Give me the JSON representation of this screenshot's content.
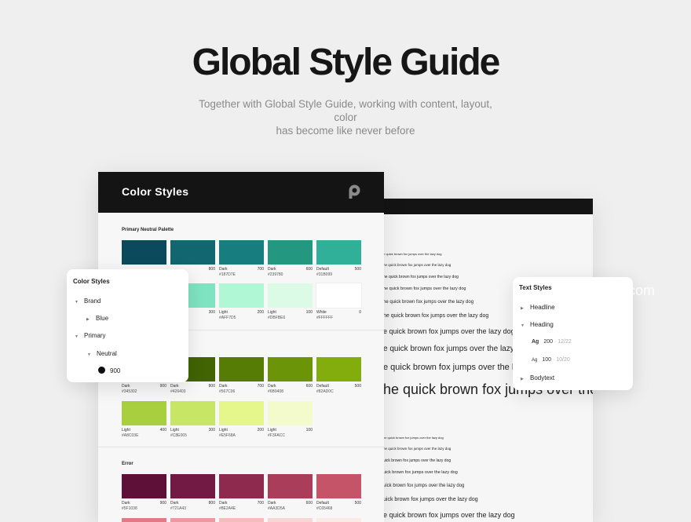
{
  "hero": {
    "title": "Global Style Guide",
    "subtitle_line1": "Together with Global Style Guide, working with content, layout, color",
    "subtitle_line2": "has become like never before"
  },
  "front_page": {
    "header_title": "Color Styles",
    "logo_icon": "p-logo-icon",
    "section_primary_neutral": "Primary Neutral Palette",
    "section_error": "Error",
    "neutral_row1": [
      {
        "name": "",
        "value": "",
        "hex": "",
        "color": "#0a4a5c"
      },
      {
        "name": "",
        "value": "800",
        "hex": "",
        "color": "#126670"
      },
      {
        "name": "Dark",
        "value": "700",
        "hex": "#187D7E",
        "color": "#187d7e"
      },
      {
        "name": "Dark",
        "value": "600",
        "hex": "#239780",
        "color": "#239780"
      },
      {
        "name": "Default",
        "value": "500",
        "hex": "#31B099",
        "color": "#31b099"
      }
    ],
    "neutral_row2": [
      {
        "name": "",
        "value": "",
        "hex": "",
        "color": "#5fd3b5"
      },
      {
        "name": "",
        "value": "300",
        "hex": "",
        "color": "#7fe3c2"
      },
      {
        "name": "Light",
        "value": "200",
        "hex": "#AFF7D5",
        "color": "#aff7d5"
      },
      {
        "name": "Light",
        "value": "100",
        "hex": "#DBFBE6",
        "color": "#dbfbe6"
      },
      {
        "name": "White",
        "value": "0",
        "hex": "#FFFFFF",
        "color": "#ffffff"
      }
    ],
    "green_row1": [
      {
        "name": "Dark",
        "value": "900",
        "hex": "#345302",
        "color": "#345302"
      },
      {
        "name": "Dark",
        "value": "800",
        "hex": "#426403",
        "color": "#426403"
      },
      {
        "name": "Dark",
        "value": "700",
        "hex": "#567C06",
        "color": "#567c06"
      },
      {
        "name": "Dark",
        "value": "600",
        "hex": "#6B9408",
        "color": "#6b9408"
      },
      {
        "name": "Default",
        "value": "500",
        "hex": "#82AD0C",
        "color": "#82ad0c"
      }
    ],
    "green_row2": [
      {
        "name": "Light",
        "value": "400",
        "hex": "#A8C03E",
        "color": "#a8cf3e"
      },
      {
        "name": "Light",
        "value": "300",
        "hex": "#C8E065",
        "color": "#c8e665"
      },
      {
        "name": "Light",
        "value": "200",
        "hex": "#E5F68A",
        "color": "#e5f68a"
      },
      {
        "name": "Light",
        "value": "100",
        "hex": "#F3FACC",
        "color": "#f3facc"
      }
    ],
    "error_row1": [
      {
        "name": "Dark",
        "value": "900",
        "hex": "#5F1038",
        "color": "#5f1038"
      },
      {
        "name": "Dark",
        "value": "800",
        "hex": "#721A43",
        "color": "#721a43"
      },
      {
        "name": "Dark",
        "value": "700",
        "hex": "#8E2A4E",
        "color": "#8e2a4e"
      },
      {
        "name": "Dark",
        "value": "600",
        "hex": "#AA3D5A",
        "color": "#aa3d5a"
      },
      {
        "name": "Default",
        "value": "500",
        "hex": "#C65468",
        "color": "#c65468"
      }
    ],
    "error_row2_colors": [
      "#e27a86",
      "#ec9a9f",
      "#f4bcbb",
      "#f8d6d3",
      "#fbe9e6"
    ]
  },
  "back_page": {
    "specimen_text": "The quick brown fox jumps over the lazy dog",
    "specimens_top": [
      {
        "text": "e quick brown fox jumps over the lazy dog",
        "size": 4
      },
      {
        "text": "he quick brown fox jumps over the lazy dog",
        "size": 4.5
      },
      {
        "text": "he quick brown fox jumps over the lazy dog",
        "size": 5
      },
      {
        "text": "he quick brown fox jumps over the lazy dog",
        "size": 5.5
      },
      {
        "text": "he quick brown fox jumps over the lazy dog",
        "size": 6
      },
      {
        "text": "he quick brown fox jumps over the lazy dog",
        "size": 7
      },
      {
        "text": "e quick brown fox jumps over the lazy dog",
        "size": 9
      },
      {
        "text": "e quick brown fox jumps over the lazy dog",
        "size": 10
      },
      {
        "text": "e quick brown fox jumps over the lazy dog",
        "size": 11
      },
      {
        "text": "he quick brown fox jumps over the lazy dog",
        "size": 18
      }
    ],
    "specimens_bottom": [
      {
        "text": "he quick brown fox jumps over the lazy dog",
        "size": 4
      },
      {
        "text": "he quick brown fox jumps over the lazy dog",
        "size": 4.5
      },
      {
        "text": "uick brown fox jumps over the lazy dog",
        "size": 5
      },
      {
        "text": "uick brown fox jumps over the lazy dog",
        "size": 5.5
      },
      {
        "text": "uick brown fox jumps over the lazy dog",
        "size": 6
      },
      {
        "text": "uick brown fox jumps over the lazy dog",
        "size": 7
      },
      {
        "text": "e quick brown fox jumps over the lazy dog",
        "size": 9
      }
    ]
  },
  "color_panel": {
    "title": "Color Styles",
    "items": [
      {
        "label": "Brand",
        "arrow": "▼"
      },
      {
        "label": "Blue",
        "arrow": "▶"
      },
      {
        "label": "Primary",
        "arrow": "▼"
      },
      {
        "label": "Neutral",
        "arrow": "▼"
      },
      {
        "label": "900",
        "swatch": "#0d0d12"
      }
    ]
  },
  "text_panel": {
    "title": "Text Styles",
    "headline": "Headline",
    "heading": "Heading",
    "bodytext": "Bodytext",
    "styles": [
      {
        "glyph": "Ag",
        "weight": "200",
        "metrics": "12/22"
      },
      {
        "glyph": "Ag",
        "weight": "100",
        "metrics": "10/20"
      }
    ]
  },
  "watermark": "t.com"
}
